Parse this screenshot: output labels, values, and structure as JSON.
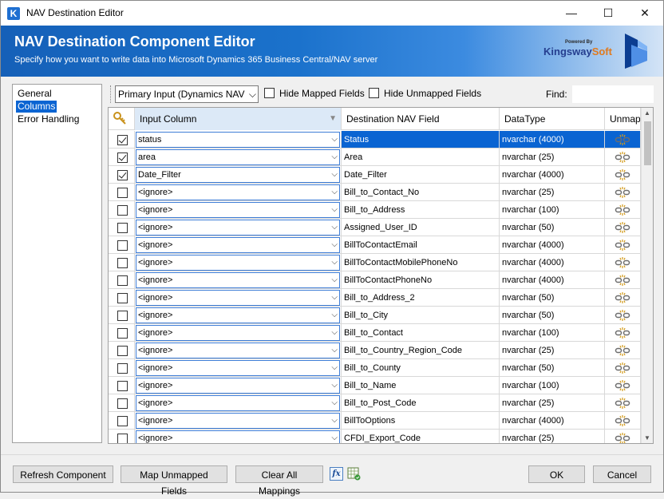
{
  "window": {
    "title": "NAV Destination Editor",
    "app_icon": "K",
    "minimize": "—",
    "maximize": "☐",
    "close": "✕"
  },
  "banner": {
    "title": "NAV Destination Component Editor",
    "subtitle": "Specify how you want to write data into Microsoft Dynamics 365 Business Central/NAV server",
    "brand_pre": "Powered By",
    "brand_name_a": "Kingsway",
    "brand_name_b": "Soft"
  },
  "nav": {
    "items": [
      "General",
      "Columns",
      "Error Handling"
    ],
    "selected": "Columns"
  },
  "toolbar": {
    "input_select": "Primary Input (Dynamics NAV",
    "hide_mapped": "Hide Mapped Fields",
    "hide_unmapped": "Hide Unmapped Fields",
    "find_label": "Find:",
    "find_value": ""
  },
  "grid": {
    "headers": {
      "input": "Input Column",
      "dest": "Destination NAV Field",
      "type": "DataType",
      "unmap": "Unmap"
    },
    "rows": [
      {
        "checked": true,
        "input": "status",
        "dest": "Status",
        "type": "nvarchar (4000)",
        "selected": true
      },
      {
        "checked": true,
        "input": "area",
        "dest": "Area",
        "type": "nvarchar (25)"
      },
      {
        "checked": true,
        "input": "Date_Filter",
        "dest": "Date_Filter",
        "type": "nvarchar (4000)"
      },
      {
        "checked": false,
        "input": "<ignore>",
        "dest": "Bill_to_Contact_No",
        "type": "nvarchar (25)"
      },
      {
        "checked": false,
        "input": "<ignore>",
        "dest": "Bill_to_Address",
        "type": "nvarchar (100)"
      },
      {
        "checked": false,
        "input": "<ignore>",
        "dest": "Assigned_User_ID",
        "type": "nvarchar (50)"
      },
      {
        "checked": false,
        "input": "<ignore>",
        "dest": "BillToContactEmail",
        "type": "nvarchar (4000)"
      },
      {
        "checked": false,
        "input": "<ignore>",
        "dest": "BillToContactMobilePhoneNo",
        "type": "nvarchar (4000)"
      },
      {
        "checked": false,
        "input": "<ignore>",
        "dest": "BillToContactPhoneNo",
        "type": "nvarchar (4000)"
      },
      {
        "checked": false,
        "input": "<ignore>",
        "dest": "Bill_to_Address_2",
        "type": "nvarchar (50)"
      },
      {
        "checked": false,
        "input": "<ignore>",
        "dest": "Bill_to_City",
        "type": "nvarchar (50)"
      },
      {
        "checked": false,
        "input": "<ignore>",
        "dest": "Bill_to_Contact",
        "type": "nvarchar (100)"
      },
      {
        "checked": false,
        "input": "<ignore>",
        "dest": "Bill_to_Country_Region_Code",
        "type": "nvarchar (25)"
      },
      {
        "checked": false,
        "input": "<ignore>",
        "dest": "Bill_to_County",
        "type": "nvarchar (50)"
      },
      {
        "checked": false,
        "input": "<ignore>",
        "dest": "Bill_to_Name",
        "type": "nvarchar (100)"
      },
      {
        "checked": false,
        "input": "<ignore>",
        "dest": "Bill_to_Post_Code",
        "type": "nvarchar (25)"
      },
      {
        "checked": false,
        "input": "<ignore>",
        "dest": "BillToOptions",
        "type": "nvarchar (4000)"
      },
      {
        "checked": false,
        "input": "<ignore>",
        "dest": "CFDI_Export_Code",
        "type": "nvarchar (25)"
      }
    ]
  },
  "buttons": {
    "refresh": "Refresh Component",
    "map_unmapped": "Map Unmapped Fields",
    "clear_all": "Clear All Mappings",
    "fx": "fx",
    "ok": "OK",
    "cancel": "Cancel"
  },
  "colors": {
    "accent": "#0a64d2",
    "banner": "#1b72cc",
    "brand_blue": "#253e8f",
    "brand_orange": "#e07a1e"
  }
}
